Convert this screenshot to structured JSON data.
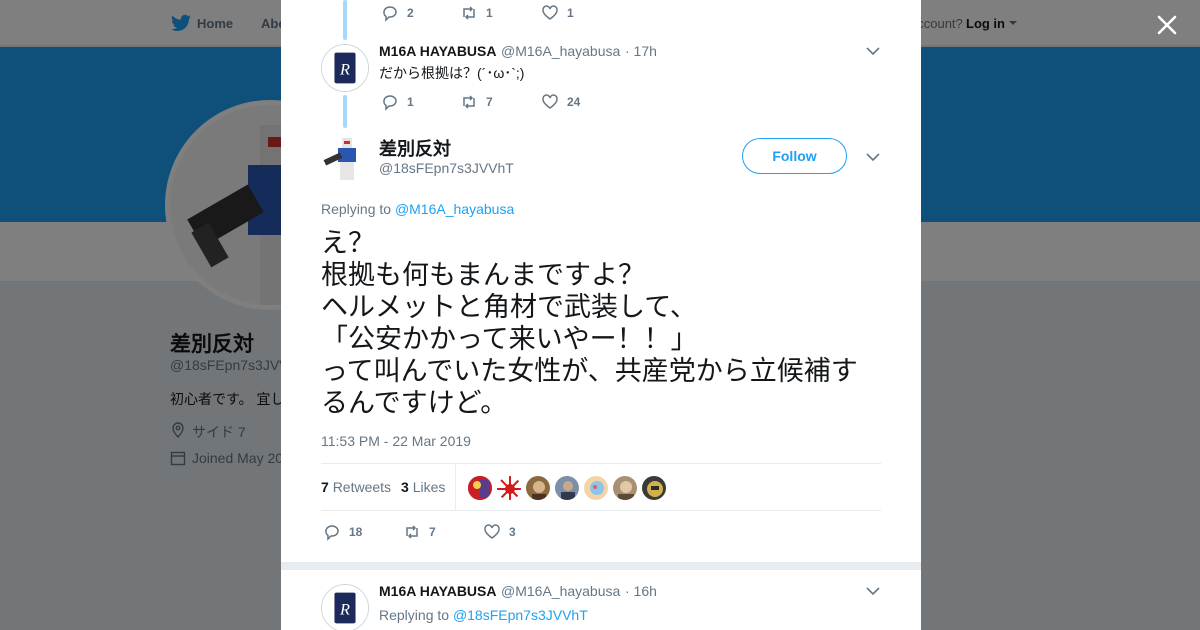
{
  "nav": {
    "home": "Home",
    "about": "Abo",
    "account_q": "account?",
    "login": "Log in"
  },
  "profile": {
    "name": "差別反対",
    "handle": "@18sFEpn7s3JVV",
    "bio": "初心者です。 宜し",
    "location": "サイド 7",
    "joined": "Joined May 20"
  },
  "tweets_above": [
    {
      "actions": {
        "replies": "2",
        "retweets": "1",
        "likes": "1"
      }
    },
    {
      "author": "M16A HAYABUSA",
      "handle": "@M16A_hayabusa",
      "time": "· 17h",
      "text": "だから根拠は？(´･ω･`;)",
      "actions": {
        "replies": "1",
        "retweets": "7",
        "likes": "24"
      }
    }
  ],
  "main_tweet": {
    "author": "差別反対",
    "handle": "@18sFEpn7s3JVVhT",
    "follow": "Follow",
    "replying_prefix": "Replying to ",
    "replying_to": "@M16A_hayabusa",
    "text_lines": [
      "え？",
      "根拠も何もまんまですよ？",
      "ヘルメットと角材で武装して、",
      "「公安かかって来いやー！！」",
      "って叫んでいた女性が、共産党から立候補す",
      "るんですけど。"
    ],
    "timestamp": "11:53 PM - 22 Mar 2019",
    "retweets_count": "7",
    "retweets_label": "Retweets",
    "likes_count": "3",
    "likes_label": "Likes",
    "actions": {
      "replies": "18",
      "retweets": "7",
      "likes": "3"
    }
  },
  "reply_tweet": {
    "author": "M16A HAYABUSA",
    "handle": "@M16A_hayabusa",
    "time": "· 16h",
    "replying_prefix": "Replying to ",
    "replying_to": "@18sFEpn7s3JVVhT"
  },
  "colors": {
    "accent": "#1da1f2",
    "text": "#14171a",
    "muted": "#657786",
    "banner": "#1da1f2"
  },
  "icons": [
    "twitter-bird-icon",
    "close-icon",
    "reply-icon",
    "retweet-icon",
    "like-icon",
    "chevron-down-icon",
    "location-icon",
    "calendar-icon"
  ]
}
